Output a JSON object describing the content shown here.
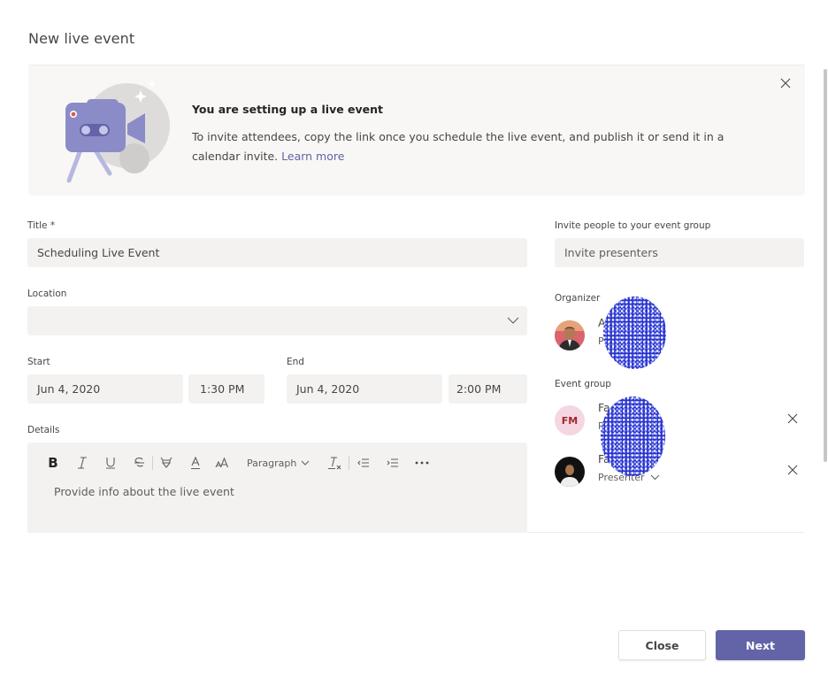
{
  "dialog": {
    "title": "New live event"
  },
  "banner": {
    "heading": "You are setting up a live event",
    "text": "To invite attendees, copy the link once you schedule the live event, and publish it or send it in a calendar invite.",
    "link": "Learn more",
    "illustration": "video-camera-illustration",
    "close_icon": "close-icon"
  },
  "form": {
    "title": {
      "label": "Title *",
      "value": "Scheduling Live Event"
    },
    "location": {
      "label": "Location",
      "value": ""
    },
    "start": {
      "label": "Start",
      "date": "Jun 4, 2020",
      "time": "1:30 PM"
    },
    "end": {
      "label": "End",
      "date": "Jun 4, 2020",
      "time": "2:00 PM"
    },
    "details": {
      "label": "Details",
      "placeholder": "Provide info about the live event",
      "toolbar": {
        "bold": "B",
        "paragraph_label": "Paragraph",
        "icons": [
          "bold-icon",
          "italic-icon",
          "underline-icon",
          "strikethrough-icon",
          "highlight-icon",
          "font-color-icon",
          "font-size-icon",
          "paragraph-dropdown",
          "clear-formatting-icon",
          "decrease-indent-icon",
          "increase-indent-icon",
          "more-options-icon"
        ]
      }
    }
  },
  "invite": {
    "label": "Invite people to your event group",
    "placeholder": "Invite presenters"
  },
  "organizer": {
    "label": "Organizer",
    "name_visible": "A                d",
    "role_visible": "P"
  },
  "event_group": {
    "label": "Event group",
    "members": [
      {
        "initials": "FM",
        "name_visible": "Fa          har",
        "role_visible": "P",
        "remove_icon": "close-icon"
      },
      {
        "initials": "",
        "name_visible": "Fa          ar",
        "role": "Presenter",
        "remove_icon": "close-icon"
      }
    ]
  },
  "footer": {
    "close_label": "Close",
    "next_label": "Next"
  },
  "colors": {
    "accent": "#6264a7",
    "input_bg": "#f3f2f1",
    "banner_bg": "#f8f7f6",
    "initials_bg": "#f4d7e3",
    "initials_fg": "#a4262c"
  }
}
